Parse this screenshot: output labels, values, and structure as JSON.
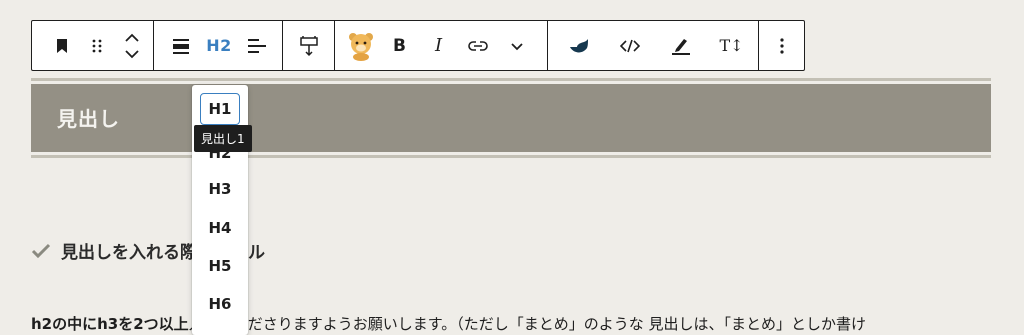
{
  "toolbar": {
    "heading_level": "H2",
    "bold_label": "B",
    "italic_label": "I",
    "tt_label": "T↕",
    "icons": [
      "bookmark-icon",
      "drag-handle-icon",
      "move-up-down-icon",
      "align-icon",
      "align-left-icon",
      "width-icon",
      "bear-icon",
      "link-icon",
      "chevron-down-icon",
      "brush-icon",
      "code-icon",
      "highlight-icon",
      "text-size-icon",
      "more-options-icon"
    ]
  },
  "heading": {
    "text": "見出し"
  },
  "dropdown": {
    "items": [
      "H1",
      "H2",
      "H3",
      "H4",
      "H5",
      "H6"
    ],
    "active": "H1",
    "tooltip": "見出し1"
  },
  "content": {
    "subheading": "見出しを入れる際のルール",
    "paragraph_bold": "h2の中にh3を2つ以上",
    "paragraph_rest": "入れてくださりますようお願いします。（ただし「まとめ」のような 見出しは、「まとめ」としか書け"
  },
  "colors": {
    "accent": "#3a7fc0",
    "heading_bg": "#949085",
    "page_bg": "#efede8",
    "border": "#c3c0b5"
  }
}
